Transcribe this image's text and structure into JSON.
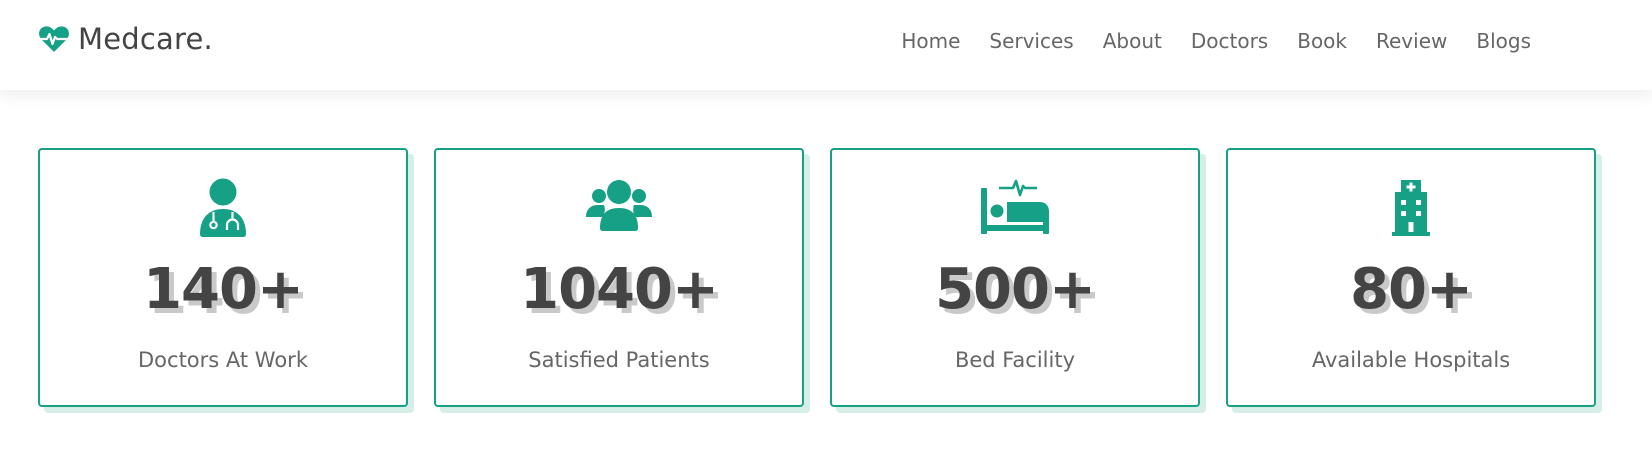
{
  "brand": {
    "name": "Medcare.",
    "icon": "heartbeat-icon",
    "accent_color": "#16a085"
  },
  "nav": {
    "items": [
      {
        "label": "Home"
      },
      {
        "label": "Services"
      },
      {
        "label": "About"
      },
      {
        "label": "Doctors"
      },
      {
        "label": "Book"
      },
      {
        "label": "Review"
      },
      {
        "label": "Blogs"
      }
    ]
  },
  "stats": [
    {
      "icon": "doctor-icon",
      "value": "140+",
      "label": "Doctors At Work"
    },
    {
      "icon": "users-icon",
      "value": "1040+",
      "label": "Satisfied Patients"
    },
    {
      "icon": "procedures-bed-icon",
      "value": "500+",
      "label": "Bed Facility"
    },
    {
      "icon": "hospital-icon",
      "value": "80+",
      "label": "Available Hospitals"
    }
  ]
}
